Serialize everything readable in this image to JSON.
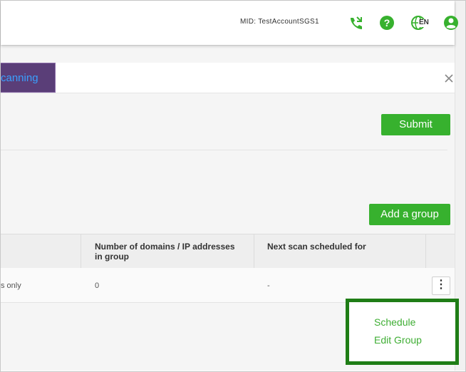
{
  "header": {
    "mid_text": "MID: TestAccountSGS1",
    "icons": [
      "phone-icon",
      "help-icon",
      "language-icon",
      "account-icon"
    ],
    "language_code": "EN",
    "accent_color": "#37b12e"
  },
  "tabs": {
    "active_label": "canning"
  },
  "actions": {
    "submit_label": "Submit",
    "add_group_label": "Add a group"
  },
  "table": {
    "headers": [
      "",
      "Number of domains / IP addresses in group",
      "Next scan scheduled for",
      ""
    ],
    "header_line1": "Number of domains / IP addresses",
    "header_line2": "in group",
    "header_next": "Next scan scheduled for",
    "rows": [
      {
        "name": "s only",
        "count": "0",
        "next_scan": "-"
      }
    ]
  },
  "context_menu": {
    "items": [
      "Schedule",
      "Edit Group"
    ]
  }
}
